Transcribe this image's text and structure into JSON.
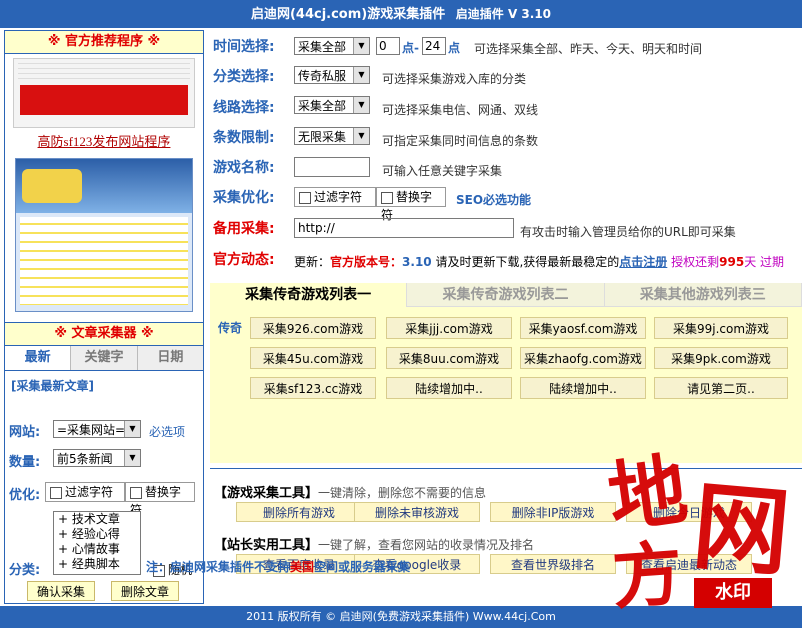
{
  "title": {
    "main": "启迪网(44cj.com)游戏采集插件",
    "version": "启迪插件 V 3.10"
  },
  "left": {
    "recommend_header": "※ 官方推荐程序 ※",
    "ad_link": "高防sf123发布网站程序",
    "article_header": "※ 文章采集器 ※",
    "tabs": [
      "最新",
      "关键字",
      "日期"
    ],
    "section_title": "[采集最新文章]",
    "site_label": "网站:",
    "site_value": "=采集网站=",
    "required_hint": "必选项",
    "count_label": "数量:",
    "count_value": "前5条新闻",
    "opt_label": "优化:",
    "opt_filter": "过滤字符",
    "opt_replace": "替换字符",
    "category_label": "分类:",
    "categories": [
      "+ 技术文章",
      "+ 经验心得",
      "+ 心情故事",
      "+ 经典脚本"
    ],
    "random_label": "随机",
    "confirm_button": "确认采集",
    "delete_button": "删除文章"
  },
  "form": {
    "time_label": "时间选择:",
    "time_value": "采集全部",
    "hour_from": "0",
    "dot": "点-",
    "hour_to": "24",
    "dot2": "点",
    "time_hint": "可选择采集全部、昨天、今天、明天和时间",
    "category_label": "分类选择:",
    "category_value": "传奇私服",
    "category_hint": "可选择采集游戏入库的分类",
    "route_label": "线路选择:",
    "route_value": "采集全部",
    "route_hint": "可选择采集电信、网通、双线",
    "limit_label": "条数限制:",
    "limit_value": "无限采集",
    "limit_hint": "可指定采集同时间信息的条数",
    "name_label": "游戏名称:",
    "name_value": "",
    "name_hint": "可输入任意关键字采集",
    "opt_label": "采集优化:",
    "opt_filter": "过滤字符",
    "opt_replace": "替换字符",
    "opt_hint": "SEO必选功能",
    "backup_label": "备用采集:",
    "backup_value": "http://",
    "backup_hint": "有攻击时输入管理员给你的URL即可采集",
    "news_label": "官方动态:",
    "news_prefix": "更新：",
    "news_version_label": "官方版本号：",
    "news_version": "3.10",
    "news_text": "请及时更新下载,获得最新最稳定的",
    "news_link": "点击注册",
    "news_auth": "授权还剩",
    "news_days": "995",
    "news_tail": "天  过期"
  },
  "panel": {
    "tabs": [
      "采集传奇游戏列表一",
      "采集传奇游戏列表二",
      "采集其他游戏列表三"
    ],
    "side_label": "传奇",
    "buttons": [
      "采集926.com游戏",
      "采集jjj.com游戏",
      "采集yaosf.com游戏",
      "采集99j.com游戏",
      "采集45u.com游戏",
      "采集8uu.com游戏",
      "采集zhaofg.com游戏",
      "采集9pk.com游戏",
      "采集sf123.cc游戏",
      "陆续增加中..",
      "陆续增加中..",
      "请见第二页.."
    ]
  },
  "tools": {
    "game_title": "【游戏采集工具】",
    "game_desc": "一键清除，删除您不需要的信息",
    "game_buttons": [
      "删除所有游戏",
      "删除未审核游戏",
      "删除非IP版游戏",
      "删除今日游戏"
    ],
    "site_title": "【站长实用工具】",
    "site_desc": "一键了解，查看您网站的收录情况及排名",
    "site_buttons": [
      "查看百度收录",
      "查看google收录",
      "查看世界级排名",
      "查看启迪最新动态"
    ]
  },
  "note": {
    "prefix": "注：启迪网采集插件不支持",
    "red": "美国",
    "suffix": "空间或服务器采集"
  },
  "footer": "2011 版权所有 © 启迪网(免费游戏采集插件) Www.44cj.Com",
  "watermark": {
    "char1": "地",
    "char2": "网",
    "char3": "方",
    "label": "水印"
  }
}
